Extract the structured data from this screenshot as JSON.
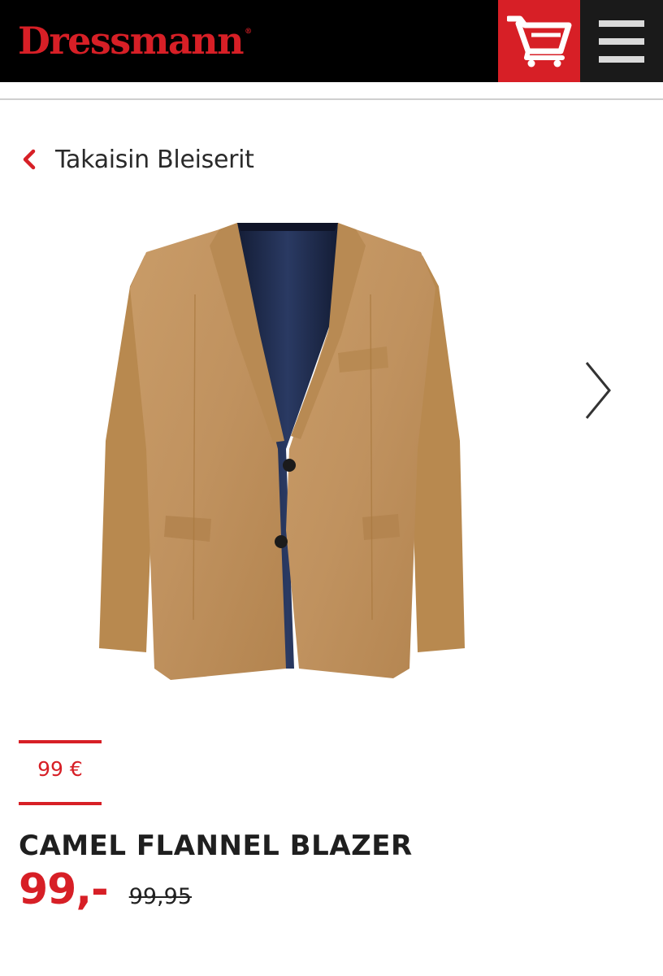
{
  "header": {
    "logo_text": "Dressmann",
    "logo_mark": "®",
    "cart_icon": "shopping-cart-icon",
    "menu_icon": "hamburger-menu-icon"
  },
  "nav": {
    "back_label": "Takaisin Bleiserit",
    "back_icon": "chevron-left-icon",
    "next_icon": "chevron-right-icon"
  },
  "product": {
    "image": "camel blazer photo",
    "badge_price": "99 €",
    "title": "CAMEL FLANNEL BLAZER",
    "price": "99,-",
    "old_price": "99,95"
  },
  "colors": {
    "brand_red": "#d71f26",
    "header_bg": "#000000",
    "menu_bg": "#1a1a1a",
    "jacket_camel": "#c0925f",
    "lining_navy": "#1c2744"
  }
}
